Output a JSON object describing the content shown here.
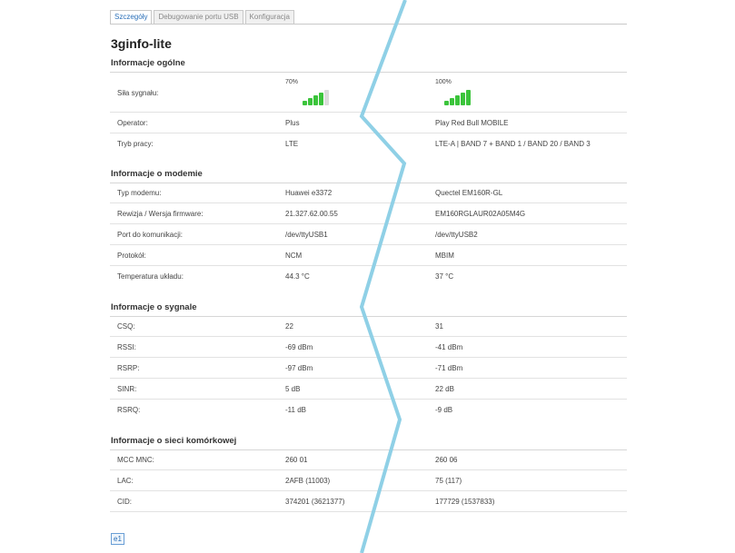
{
  "tabs": [
    "Szczegóły",
    "Debugowanie portu USB",
    "Konfiguracja"
  ],
  "title": "3ginfo-lite",
  "sections": {
    "general": "Informacje ogólne",
    "modem": "Informacje o modemie",
    "signal": "Informacje o sygnale",
    "cell": "Informacje o sieci komórkowej"
  },
  "general": {
    "signal_label": "Siła sygnału:",
    "signal_left": "70%",
    "signal_right": "100%",
    "signal_left_level": 0.7,
    "signal_right_level": 1.0,
    "operator_label": "Operator:",
    "operator_left": "Plus",
    "operator_right": "Play Red Bull MOBILE",
    "mode_label": "Tryb pracy:",
    "mode_left": "LTE",
    "mode_right": "LTE-A | BAND 7 + BAND 1 / BAND 20 / BAND 3"
  },
  "modem": {
    "type_label": "Typ modemu:",
    "type_left": "Huawei e3372",
    "type_right": "Quectel EM160R-GL",
    "fw_label": "Rewizja / Wersja firmware:",
    "fw_left": "21.327.62.00.55",
    "fw_right": "EM160RGLAUR02A05M4G",
    "port_label": "Port do komunikacji:",
    "port_left": "/dev/ttyUSB1",
    "port_right": "/dev/ttyUSB2",
    "proto_label": "Protokół:",
    "proto_left": "NCM",
    "proto_right": "MBIM",
    "temp_label": "Temperatura układu:",
    "temp_left": "44.3 °C",
    "temp_right": "37 °C"
  },
  "signal": {
    "csq_label": "CSQ:",
    "csq_left": "22",
    "csq_right": "31",
    "rssi_label": "RSSI:",
    "rssi_left": "-69 dBm",
    "rssi_right": "-41 dBm",
    "rsrp_label": "RSRP:",
    "rsrp_left": "-97 dBm",
    "rsrp_right": "-71 dBm",
    "sinr_label": "SINR:",
    "sinr_left": "5 dB",
    "sinr_right": "22 dB",
    "rsrq_label": "RSRQ:",
    "rsrq_left": "-11 dB",
    "rsrq_right": "-9 dB"
  },
  "cell": {
    "mcc_label": "MCC MNC:",
    "mcc_left": "260 01",
    "mcc_right": "260 06",
    "lac_label": "LAC:",
    "lac_left": "2AFB (11003)",
    "lac_right": "75 (117)",
    "cid_label": "CID:",
    "cid_left": "374201 (3621377)",
    "cid_right": "177729 (1537833)"
  },
  "legend": "e1",
  "colors": {
    "accent": "#2a6fb8",
    "signal_bar": "#3bc43b",
    "divider_line": "#8fd0e6"
  }
}
